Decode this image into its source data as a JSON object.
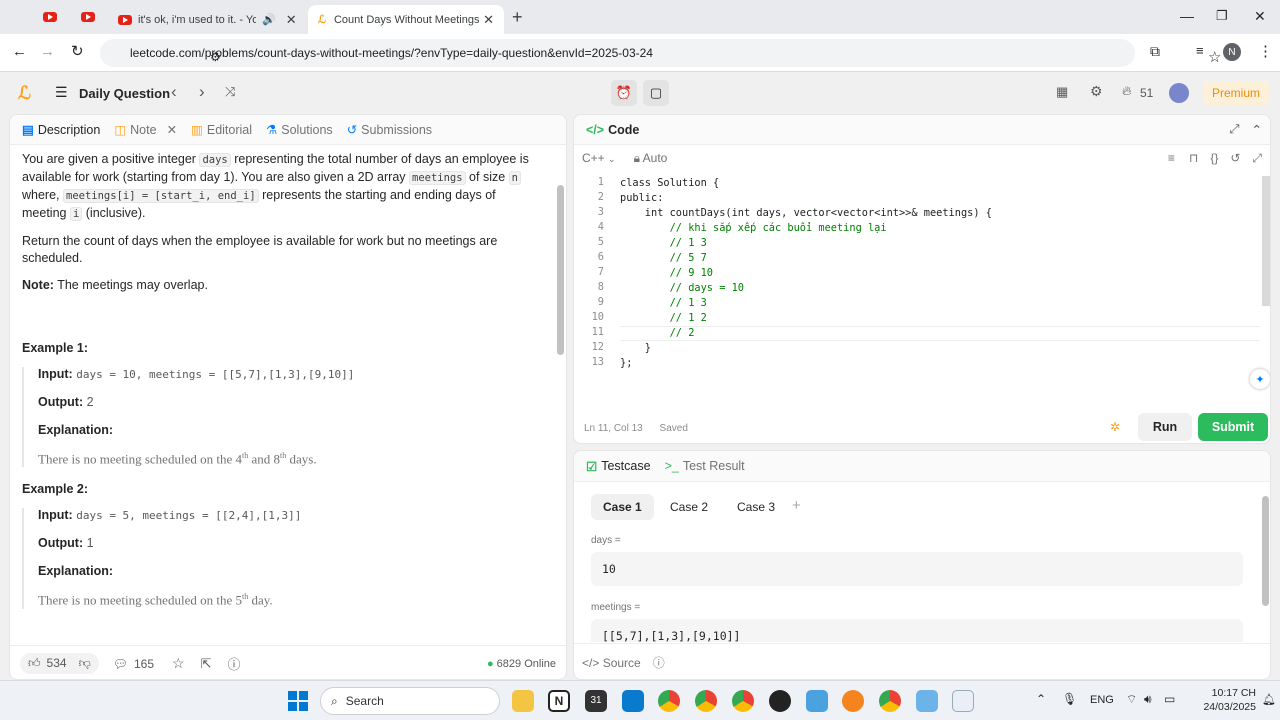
{
  "browser": {
    "tabs": [
      {
        "label": "it's ok, i'm used to it. - You"
      },
      {
        "label": "Count Days Without Meetings"
      }
    ],
    "url": "leetcode.com/problems/count-days-without-meetings/?envType=daily-question&envId=2025-03-24",
    "profile_initial": "N"
  },
  "header": {
    "daily_label": "Daily Question",
    "streak": "51",
    "premium": "Premium"
  },
  "left_tabs": [
    "Description",
    "Note",
    "Editorial",
    "Solutions",
    "Submissions"
  ],
  "description": {
    "p1_a": "You are given a positive integer ",
    "p1_code1": "days",
    "p1_b": " representing the total number of days an employee is available for work (starting from day 1). You are also given a 2D array ",
    "p1_code2": "meetings",
    "p1_c": " of size ",
    "p1_code3": "n",
    "p1_d": " where, ",
    "p1_code4": "meetings[i] = [start_i, end_i]",
    "p1_e": " represents the starting and ending days of meeting ",
    "p1_code5": "i",
    "p1_f": " (inclusive).",
    "p2": "Return the count of days when the employee is available for work but no meetings are scheduled.",
    "note_label": "Note:",
    "note_text": " The meetings may overlap.",
    "ex1_title": "Example 1:",
    "ex1_input_label": "Input:",
    "ex1_input": "days = 10, meetings = [[5,7],[1,3],[9,10]]",
    "ex1_output_label": "Output:",
    "ex1_output": "2",
    "ex1_expl_label": "Explanation:",
    "ex1_expl_a": "There is no meeting scheduled on the 4",
    "ex1_expl_sup1": "th",
    "ex1_expl_b": " and 8",
    "ex1_expl_sup2": "th",
    "ex1_expl_c": " days.",
    "ex2_title": "Example 2:",
    "ex2_input_label": "Input:",
    "ex2_input": "days = 5, meetings = [[2,4],[1,3]]",
    "ex2_output_label": "Output:",
    "ex2_output": "1",
    "ex2_expl_label": "Explanation:",
    "ex2_expl_a": "There is no meeting scheduled on the 5",
    "ex2_expl_sup": "th",
    "ex2_expl_b": " day."
  },
  "left_footer": {
    "likes": "534",
    "comments": "165",
    "online": "6829 Online"
  },
  "code_panel": {
    "title": "Code",
    "language": "C++",
    "auto": "Auto",
    "lines": [
      "class Solution {",
      "public:",
      "    int countDays(int days, vector<vector<int>>& meetings) {",
      "        // khi sắp xếp các buổi meeting lại",
      "        // 1 3",
      "        // 5 7",
      "        // 9 10",
      "        // days = 10",
      "        // 1 3",
      "        // 1 2",
      "        // 2",
      "    }",
      "};"
    ],
    "status": "Ln 11, Col 13",
    "saved": "Saved",
    "run": "Run",
    "submit": "Submit"
  },
  "testcase": {
    "tab1": "Testcase",
    "tab2": "Test Result",
    "cases": [
      "Case 1",
      "Case 2",
      "Case 3"
    ],
    "days_label": "days =",
    "days_value": "10",
    "meetings_label": "meetings =",
    "meetings_value": "[[5,7],[1,3],[9,10]]",
    "source": "Source"
  },
  "taskbar": {
    "search": "Search",
    "lang": "ENG",
    "time": "10:17 CH",
    "date": "24/03/2025"
  },
  "colors": {
    "accent": "#ffa116",
    "submit": "#2cbb5d",
    "tab_active": "#ffffff"
  }
}
